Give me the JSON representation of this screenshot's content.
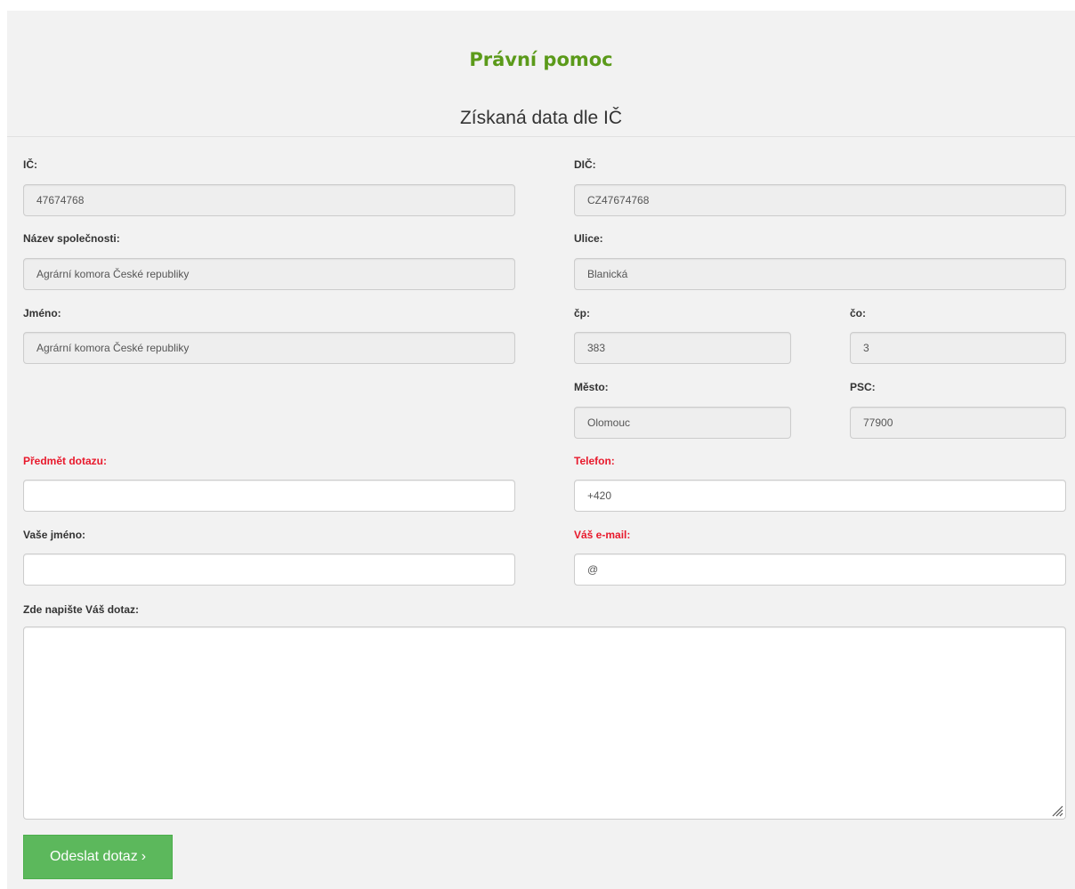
{
  "header": {
    "app_title": "Právní pomoc",
    "section_title": "Získaná data dle IČ"
  },
  "fields": {
    "ic": {
      "label": "IČ:",
      "value": "47674768"
    },
    "dic": {
      "label": "DIČ:",
      "value": "CZ47674768"
    },
    "nazev": {
      "label": "Název společnosti:",
      "value": "Agrární komora České republiky"
    },
    "ulice": {
      "label": "Ulice:",
      "value": "Blanická"
    },
    "jmeno": {
      "label": "Jméno:",
      "value": "Agrární komora České republiky"
    },
    "cp": {
      "label": "čp:",
      "value": "383"
    },
    "co": {
      "label": "čo:",
      "value": "3"
    },
    "mesto": {
      "label": "Město:",
      "value": "Olomouc"
    },
    "psc": {
      "label": "PSC:",
      "value": "77900"
    },
    "predmet": {
      "label": "Předmět dotazu:",
      "value": ""
    },
    "telefon": {
      "label": "Telefon:",
      "value": "+420"
    },
    "vase_jmeno": {
      "label": "Vaše jméno:",
      "value": ""
    },
    "email": {
      "label": "Váš e-mail:",
      "value": "@"
    },
    "dotaz": {
      "label": "Zde napište Váš dotaz:",
      "value": ""
    }
  },
  "submit": {
    "label": "Odeslat dotaz",
    "arrow": "›"
  },
  "colors": {
    "title_green": "#5b9a1a",
    "required_red": "#e8192c",
    "button_green": "#5cb85c",
    "panel_bg": "#f2f2f2",
    "readonly_bg": "#eeeeee"
  }
}
